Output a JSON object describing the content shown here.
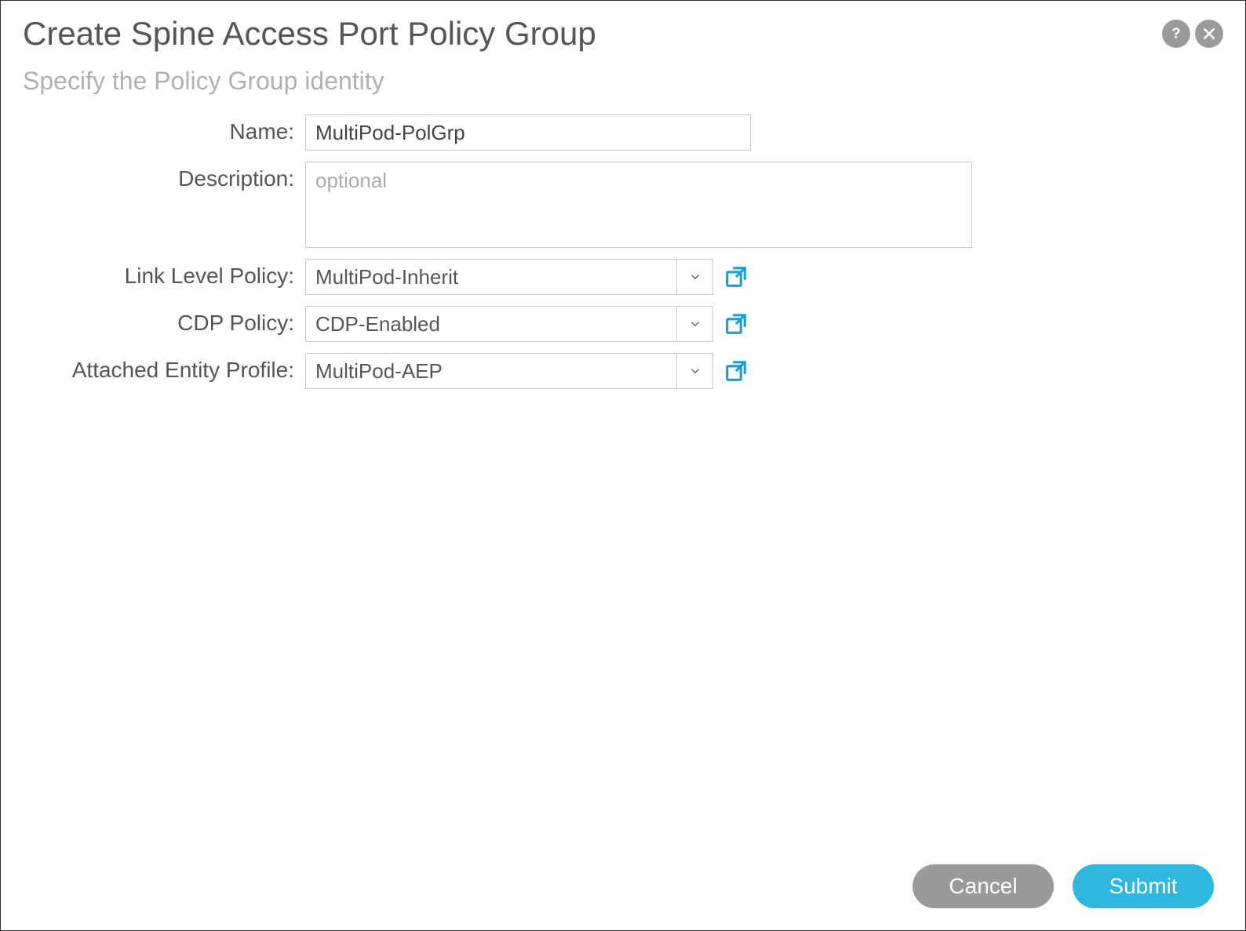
{
  "header": {
    "title": "Create Spine Access Port Policy Group",
    "subtitle": "Specify the Policy Group identity"
  },
  "form": {
    "name": {
      "label": "Name:",
      "value": "MultiPod-PolGrp"
    },
    "description": {
      "label": "Description:",
      "placeholder": "optional",
      "value": ""
    },
    "link_level_policy": {
      "label": "Link Level Policy:",
      "value": "MultiPod-Inherit"
    },
    "cdp_policy": {
      "label": "CDP Policy:",
      "value": "CDP-Enabled"
    },
    "attached_entity_profile": {
      "label": "Attached Entity Profile:",
      "value": "MultiPod-AEP"
    }
  },
  "footer": {
    "cancel": "Cancel",
    "submit": "Submit"
  }
}
